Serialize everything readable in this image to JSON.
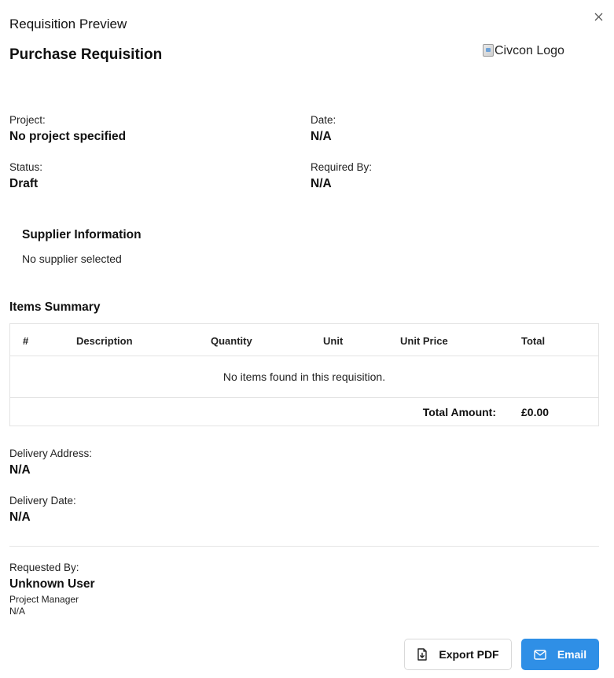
{
  "dialog": {
    "title": "Requisition Preview"
  },
  "document": {
    "title": "Purchase Requisition",
    "logo_alt": "Civcon Logo"
  },
  "details": {
    "project_label": "Project:",
    "project_value": "No project specified",
    "date_label": "Date:",
    "date_value": "N/A",
    "status_label": "Status:",
    "status_value": "Draft",
    "required_by_label": "Required By:",
    "required_by_value": "N/A"
  },
  "supplier": {
    "title": "Supplier Information",
    "text": "No supplier selected"
  },
  "items": {
    "title": "Items Summary",
    "columns": [
      "#",
      "Description",
      "Quantity",
      "Unit",
      "Unit Price",
      "Total"
    ],
    "empty_text": "No items found in this requisition.",
    "total_label": "Total Amount:",
    "total_value": "£0.00"
  },
  "delivery": {
    "address_label": "Delivery Address:",
    "address_value": "N/A",
    "date_label": "Delivery Date:",
    "date_value": "N/A"
  },
  "requester": {
    "label": "Requested By:",
    "name": "Unknown User",
    "role": "Project Manager",
    "extra": "N/A"
  },
  "actions": {
    "export_label": "Export PDF",
    "email_label": "Email"
  },
  "colors": {
    "primary": "#2f8fe6",
    "border": "#e3e3e3"
  },
  "icons": {
    "close": "close-icon",
    "export": "file-download-icon",
    "email": "mail-icon",
    "logo": "broken-image-icon"
  }
}
